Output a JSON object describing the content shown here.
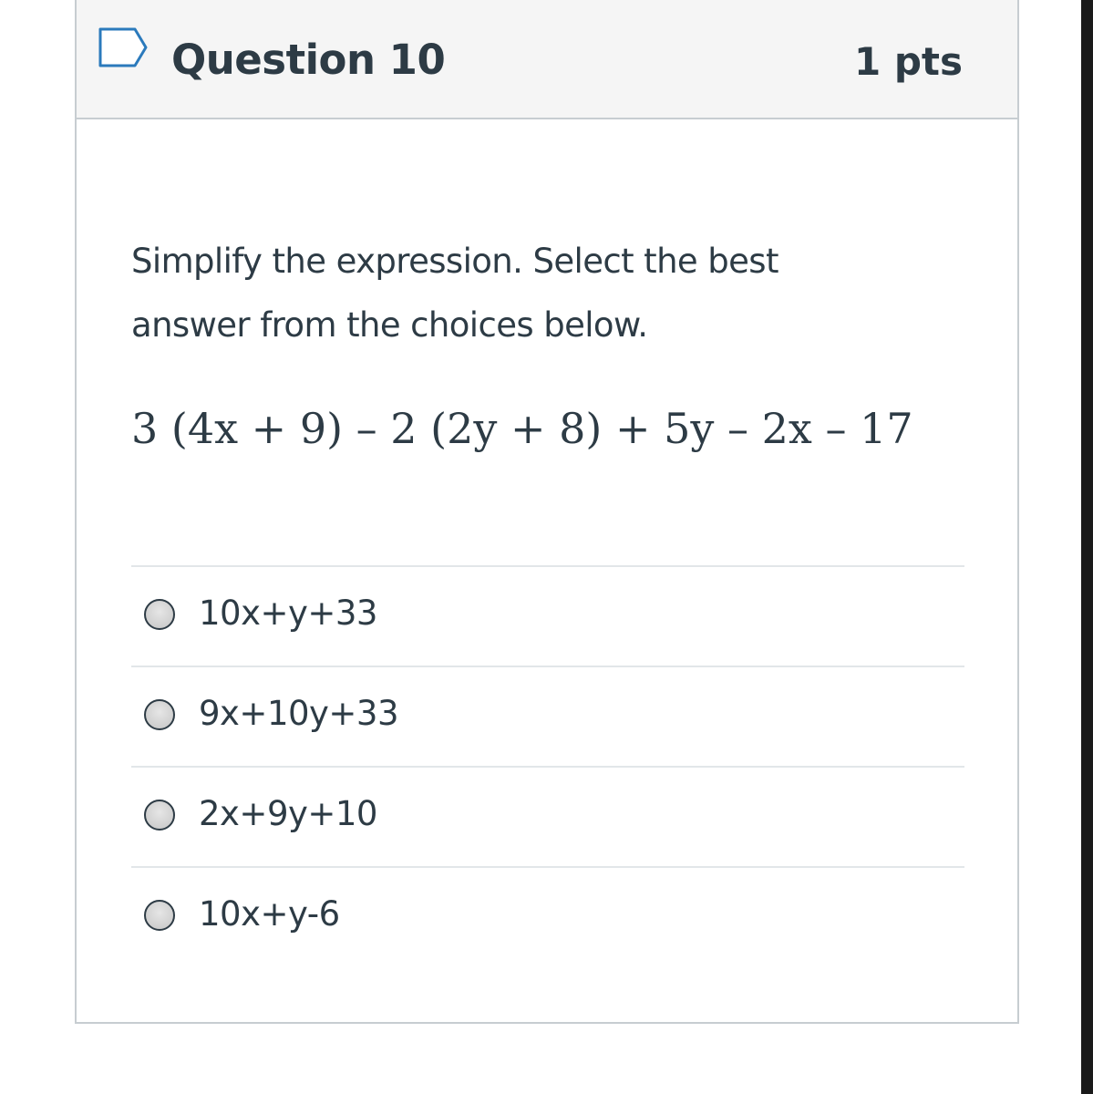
{
  "question": {
    "title": "Question 10",
    "points": "1 pts",
    "flag_icon": "flag-outline-icon",
    "prompt": "Simplify the expression. Select the best answer from the choices below.",
    "expression": "3 (4x + 9) – 2 (2y + 8) + 5y – 2x – 17",
    "answers": [
      {
        "label": "10x+y+33"
      },
      {
        "label": "9x+10y+33"
      },
      {
        "label": "2x+9y+10"
      },
      {
        "label": "10x+y-6"
      }
    ]
  },
  "colors": {
    "text": "#2d3b45",
    "header_bg": "#f5f5f5",
    "border": "#c7cdd1",
    "divider": "#e2e6e9",
    "flag": "#2b7abc"
  }
}
